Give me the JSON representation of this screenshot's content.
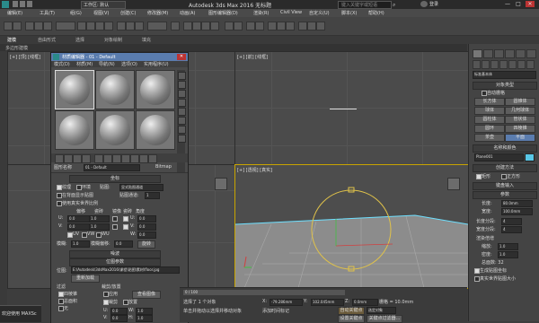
{
  "app": {
    "title": "Autodesk 3ds Max 2016    无标题",
    "workspace": "工作区: 默认",
    "search_placeholder": "键入关键字或短语",
    "user": "登录",
    "win_controls": [
      "—",
      "□",
      "✕"
    ]
  },
  "menu": [
    "编辑(E)",
    "工具(T)",
    "组(G)",
    "视图(V)",
    "创建(C)",
    "修改器(M)",
    "动画(A)",
    "图形编辑器(D)",
    "渲染(R)",
    "Civil View",
    "自定义(U)",
    "脚本(X)",
    "帮助(H)"
  ],
  "ribbon_tabs": [
    "建模",
    "自由形式",
    "选择",
    "对象绘制",
    "填充"
  ],
  "subribbon": "多边形建模",
  "viewports": {
    "top_left": "[+] [顶] [线框]",
    "top_right": "[+] [前] [线框]",
    "perspective": "[+] [透视] [真实]"
  },
  "material_editor": {
    "title": "材质编辑器 - 01 - Default",
    "menu": [
      "模式(D)",
      "材质(M)",
      "导航(N)",
      "选项(O)",
      "实用程序(U)"
    ],
    "material_name": "01 - Default",
    "material_type": "Bitmap",
    "name_label": "图形名称",
    "rollout_coords": "坐标",
    "texture": "纹理",
    "environ": "环境",
    "mapping_label": "贴图:",
    "mapping_value": "显式贴图通道",
    "show_map_on_back": "在背面显示贴图",
    "map_channel_label": "贴图通道:",
    "map_channel_value": "1",
    "use_real_world": "使用真实世界比例",
    "offset_label": "偏移",
    "tiling_label": "瓷砖",
    "mirror_label": "镜像",
    "tile_label": "瓷砖",
    "angle_label": "角度",
    "u_label": "U:",
    "v_label": "V:",
    "w_label": "W:",
    "u_offset": "0.0",
    "v_offset": "0.0",
    "u_tiling": "1.0",
    "v_tiling": "1.0",
    "u_angle": "0.0",
    "v_angle": "0.0",
    "w_angle": "0.0",
    "uv_options": [
      "UV",
      "VW",
      "WU"
    ],
    "blur_label": "模糊:",
    "blur_value": "1.0",
    "blur_offset_label": "模糊偏移:",
    "blur_offset_value": "0.0",
    "rotate_label": "旋转",
    "noise_rollout": "噪波",
    "bitmap_params_rollout": "位图参数",
    "bitmap_label": "位图:",
    "bitmap_path": "E:\\Autodesk\\3dsMax2016\\课程\\贴图\\素材\\floor.jpg",
    "reload_label": "重新加载",
    "filtering_label": "过滤",
    "filter_options": [
      "四棱锥",
      "总面积",
      "无"
    ],
    "cropping_label": "裁剪/放置",
    "apply_label": "应用",
    "view_image_label": "查看图像",
    "crop_label": "裁剪",
    "place_label": "放置",
    "crop_u": "0.0",
    "crop_v": "0.0",
    "crop_w": "1.0",
    "crop_h": "1.0"
  },
  "command_panel": {
    "dropdown": "标准基本体",
    "object_type_hdr": "对象类型",
    "autogrid": "自动栅格",
    "buttons": [
      "长方体",
      "圆锥体",
      "球体",
      "几何球体",
      "圆柱体",
      "管状体",
      "圆环",
      "四棱锥",
      "茶壶",
      "平面"
    ],
    "name_color_hdr": "名称和颜色",
    "object_name": "Plane001",
    "creation_method_hdr": "创建方法",
    "creation_options": [
      "矩形",
      "正方形"
    ],
    "keyboard_hdr": "键盘输入",
    "params_hdr": "参数",
    "length_label": "长度:",
    "length_value": "80.0mm",
    "width_label": "宽度:",
    "width_value": "100.0mm",
    "length_segs_label": "长度分段:",
    "length_segs_value": "4",
    "width_segs_label": "宽度分段:",
    "width_segs_value": "4",
    "render_mult_hdr": "渲染倍增",
    "scale_label": "缩放:",
    "scale_value": "1.0",
    "density_label": "密度:",
    "density_value": "1.0",
    "total_faces": "总面数: 32",
    "gen_coords": "生成贴图坐标",
    "real_world": "真实世界贴图大小"
  },
  "status": {
    "welcome": "欢迎使用 MAXSc",
    "selected": "选择了 1 个对象",
    "hint": "单击并拖动以选择并移动对象",
    "x_label": "X:",
    "x_value": "-79.286mm",
    "y_label": "Y:",
    "y_value": "102.045mm",
    "z_label": "Z:",
    "z_value": "0.0mm",
    "grid": "栅格 = 10.0mm",
    "autokey": "自动关键点",
    "selected_opt": "选定对象",
    "set_key": "设置关键点",
    "key_filters": "关键点过滤器...",
    "add_time_tag": "添加时间标记",
    "frame": "0 / 100"
  }
}
